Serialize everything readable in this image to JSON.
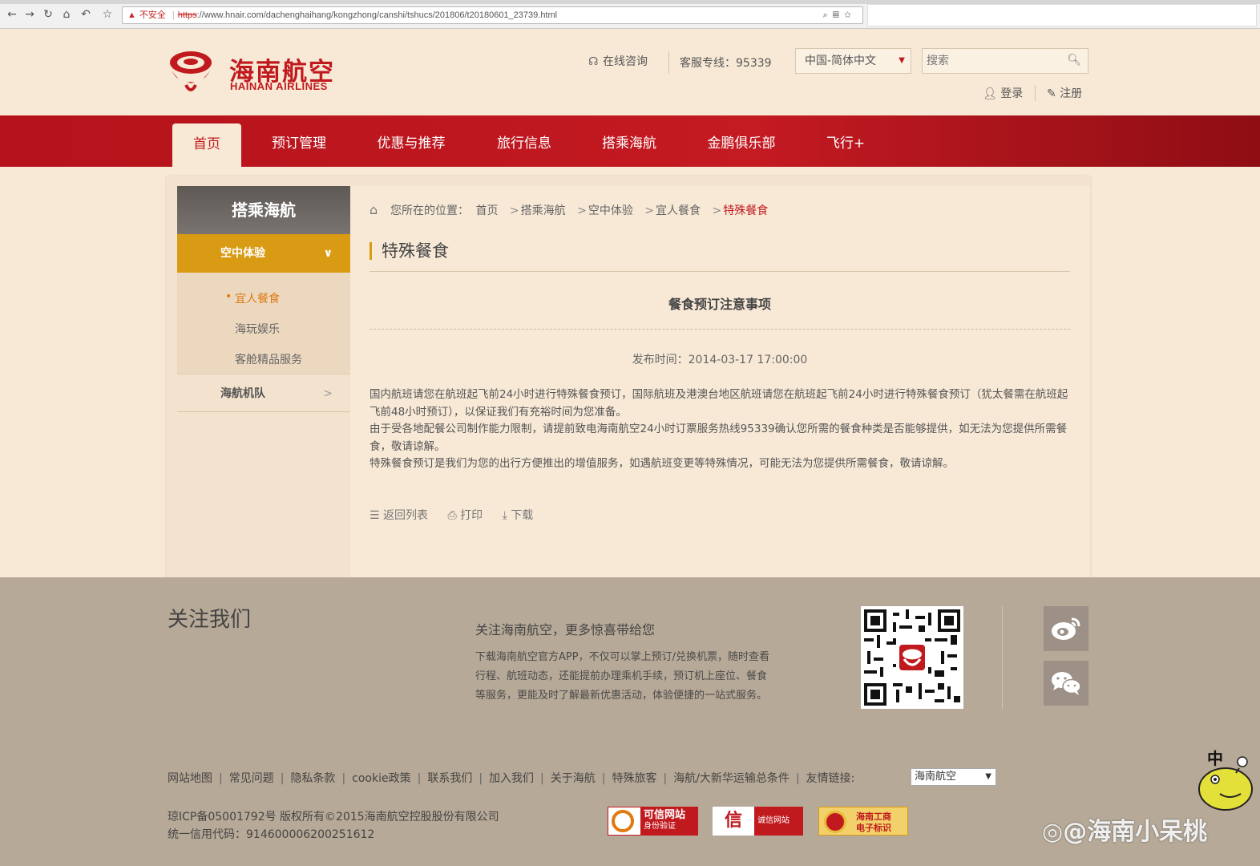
{
  "browser": {
    "security_label": "不安全",
    "url_scheme": "https",
    "url_rest": "://www.hnair.com/dachenghaihang/kongzhong/canshi/tshucs/201806/t20180601_23739.html"
  },
  "header": {
    "logo_cn": "海南航空",
    "logo_en": "HAINAN AIRLINES",
    "consult": "在线咨询",
    "hotline": "客服专线：95339",
    "language": "中国-简体中文",
    "search_placeholder": "搜索",
    "login": "登录",
    "register": "注册"
  },
  "nav": {
    "items": [
      {
        "label": "首页"
      },
      {
        "label": "预订管理"
      },
      {
        "label": "优惠与推荐"
      },
      {
        "label": "旅行信息"
      },
      {
        "label": "搭乘海航"
      },
      {
        "label": "金鹏俱乐部"
      },
      {
        "label": "飞行+"
      }
    ]
  },
  "sidebar": {
    "title": "搭乘海航",
    "active_group": "空中体验",
    "subs": [
      "宜人餐食",
      "海玩娱乐",
      "客舱精品服务"
    ],
    "group2": "海航机队"
  },
  "breadcrumb": {
    "prefix": "您所在的位置：",
    "items": [
      "首页",
      "搭乘海航",
      "空中体验",
      "宜人餐食",
      "特殊餐食"
    ]
  },
  "article": {
    "section_title": "特殊餐食",
    "title": "餐食预订注意事项",
    "published": "发布时间：2014-03-17 17:00:00",
    "paragraphs": [
      "国内航班请您在航班起飞前24小时进行特殊餐食预订，国际航班及港澳台地区航班请您在航班起飞前24小时进行特殊餐食预订（犹太餐需在航班起飞前48小时预订），以保证我们有充裕时间为您准备。",
      "由于受各地配餐公司制作能力限制，请提前致电海南航空24小时订票服务热线95339确认您所需的餐食种类是否能够提供，如无法为您提供所需餐食，敬请谅解。",
      "特殊餐食预订是我们为您的出行方便推出的增值服务，如遇航班变更等特殊情况，可能无法为您提供所需餐食，敬请谅解。"
    ],
    "actions": {
      "back": "返回列表",
      "print": "打印",
      "download": "下载"
    }
  },
  "footer": {
    "follow": "关注我们",
    "subtitle": "关注海南航空，更多惊喜带给您",
    "description": "下载海南航空官方APP，不仅可以掌上预订/兑换机票，随时查看行程、航班动态，还能提前办理乘机手续，预订机上座位、餐食等服务，更能及时了解最新优惠活动，体验便捷的一站式服务。",
    "links": [
      "网站地图",
      "常见问题",
      "隐私条款",
      "cookie政策",
      "联系我们",
      "加入我们",
      "关于海航",
      "特殊旅客",
      "海航/大新华运输总条件"
    ],
    "friend_label": "友情链接:",
    "friend_value": "海南航空",
    "icp": "琼ICP备05001792号 版权所有©2015海南航空控股股份有限公司",
    "credit_code": "统一信用代码：914600006200251612",
    "badges": {
      "b1_line1": "可信网站",
      "b1_line2": "身份验证",
      "b2_left": "信",
      "b2_text": "诚信网站",
      "b3_line1": "海南工商",
      "b3_line2": "电子标识"
    }
  },
  "overlay": {
    "ime_char": "中",
    "watermark": "@海南小呆桃"
  }
}
